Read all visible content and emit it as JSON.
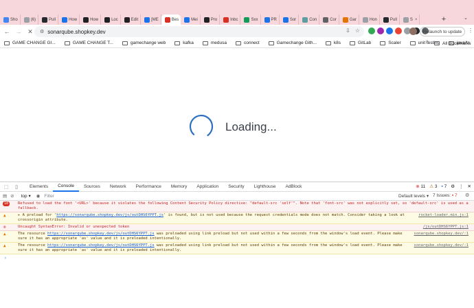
{
  "tabs": [
    {
      "label": "Sho",
      "icon": "app-icon",
      "color": "#4285f4"
    },
    {
      "label": "(6)",
      "icon": "app-icon",
      "color": "#9aa0a6"
    },
    {
      "label": "Pull",
      "icon": "github-icon",
      "color": "#24292e"
    },
    {
      "label": "How",
      "icon": "app-icon",
      "color": "#1a73e8"
    },
    {
      "label": "How",
      "icon": "app-icon",
      "color": "#202124"
    },
    {
      "label": "Loc",
      "icon": "app-icon",
      "color": "#202124"
    },
    {
      "label": "Edit",
      "icon": "app-icon",
      "color": "#202124"
    },
    {
      "label": "[ME",
      "icon": "app-icon",
      "color": "#1a73e8"
    },
    {
      "label": "Bes",
      "icon": "app-icon",
      "color": "#d93025",
      "active": true
    },
    {
      "label": "Mei",
      "icon": "app-icon",
      "color": "#1a73e8"
    },
    {
      "label": "Pro",
      "icon": "app-icon",
      "color": "#202124"
    },
    {
      "label": "Inbc",
      "icon": "mail-icon",
      "color": "#d93025"
    },
    {
      "label": "Sxx",
      "icon": "app-icon",
      "color": "#0f9d58"
    },
    {
      "label": "PR",
      "icon": "app-icon",
      "color": "#1a73e8"
    },
    {
      "label": "Sor",
      "icon": "app-icon",
      "color": "#1a73e8"
    },
    {
      "label": "Con",
      "icon": "app-icon",
      "color": "#5f9ea0"
    },
    {
      "label": "Cor",
      "icon": "app-icon",
      "color": "#5f6368"
    },
    {
      "label": "Gar",
      "icon": "app-icon",
      "color": "#e37400"
    },
    {
      "label": "Hon",
      "icon": "app-icon",
      "color": "#9aa0a6"
    },
    {
      "label": "Pull",
      "icon": "github-icon",
      "color": "#24292e"
    },
    {
      "label": "S",
      "icon": "app-icon",
      "color": "#9aa0a6",
      "close": "×"
    }
  ],
  "new_tab_label": "+",
  "toolbar": {
    "url": "sonarqube.shopkey.dev",
    "relaunch_label": "Relaunch to update",
    "menu": "⋮"
  },
  "bookmarks": [
    "GAME CHANGE GI...",
    "GAME CHANGE T...",
    "gamechange web",
    "kafka",
    "medusa",
    "connect",
    "Gamechange Gith...",
    "k8s",
    "GitLab",
    "Scaler",
    "unit testing",
    "java/ts"
  ],
  "bookmarks_more": "»",
  "all_bookmarks": "All Bookmarks",
  "page": {
    "loading_text": "Loading..."
  },
  "devtools": {
    "tabs": [
      "Elements",
      "Console",
      "Sources",
      "Network",
      "Performance",
      "Memory",
      "Application",
      "Security",
      "Lighthouse",
      "AdBlock"
    ],
    "active_tab": "Console",
    "errors": "11",
    "warnings": "3",
    "issues_badge": "7",
    "context": "top",
    "filter_placeholder": "Filter",
    "levels": "Default levels",
    "issues_label": "7 Issues:",
    "issues_count": "7",
    "messages": [
      {
        "level": "error",
        "badge": "18",
        "text": "Refused to load the font '<URL>' because it violates the following Content Security Policy directive: \"default-src 'self'\". Note that 'font-src' was not explicitly set, so 'default-src' is used as a fallback.",
        "src": ""
      },
      {
        "level": "warn",
        "badge": "",
        "text_pre": "▸ A preload for '",
        "link": "https://sonarqube.shopkey.dev/js/outDHS6YPPT.js",
        "text_post": "' is found, but is not used because the request credentials mode does not match. Consider taking a look at crossorigin attribute.",
        "src": "rocket-loader.min.js:1"
      },
      {
        "level": "error",
        "badge": "",
        "text": "Uncaught SyntaxError: Invalid or unexpected token",
        "src": "/js/outDHS6YPPT.js:1"
      },
      {
        "level": "warn",
        "badge": "",
        "text_pre": "The resource ",
        "link": "https://sonarqube.shopkey.dev/js/outDHS6YPPT.js",
        "text_post": " was preloaded using link preload but not used within a few seconds from the window's load event. Please make sure it has an appropriate 'as' value and it is preloaded intentionally.",
        "src": "sonarqube.shopkey.dev/:1"
      },
      {
        "level": "warn",
        "badge": "",
        "text_pre": "The resource ",
        "link": "https://sonarqube.shopkey.dev/js/outDHS6YPPT.js",
        "text_post": " was preloaded using link preload but not used within a few seconds from the window's load event. Please make sure it has an appropriate 'as' value and it is preloaded intentionally.",
        "src": "sonarqube.shopkey.dev/:1"
      }
    ],
    "prompt": "›"
  }
}
